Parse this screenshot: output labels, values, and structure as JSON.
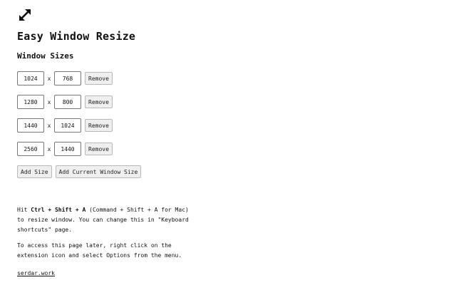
{
  "app": {
    "logo_icon": "expand-arrows-icon",
    "title": "Easy Window Resize"
  },
  "sizes_section": {
    "title": "Window Sizes",
    "separator": "x",
    "remove_label": "Remove",
    "rows": [
      {
        "width": "1024",
        "height": "768"
      },
      {
        "width": "1280",
        "height": "800"
      },
      {
        "width": "1440",
        "height": "1024"
      },
      {
        "width": "2560",
        "height": "1440"
      }
    ]
  },
  "actions": {
    "add_size_label": "Add Size",
    "add_current_label": "Add Current Window Size"
  },
  "info": {
    "shortcut_prefix": "Hit ",
    "shortcut_keys": "Ctrl + Shift + A",
    "shortcut_suffix": " (Command + Shift + A for Mac) to resize window. You can change this in \"Keyboard shortcuts\" page.",
    "options_text": "To access this page later, right click on the extension icon and select Options from the menu.",
    "author_link": "serdar.work"
  },
  "colors": {
    "text": "#111111",
    "button_bg": "#efefef",
    "input_border": "#767676"
  }
}
